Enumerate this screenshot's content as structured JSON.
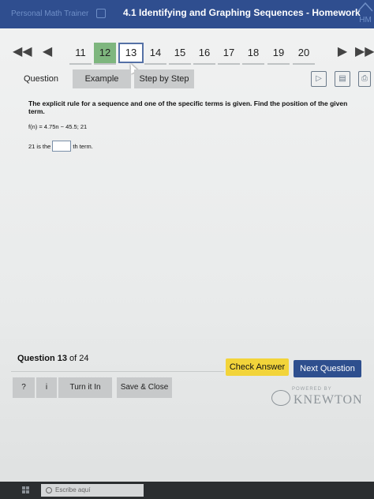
{
  "header": {
    "brand": "Personal Math Trainer",
    "title": "4.1 Identifying and Graphing Sequences - Homework",
    "logo": "HM"
  },
  "nav": {
    "questions": [
      {
        "label": "11",
        "state": "normal"
      },
      {
        "label": "12",
        "state": "done"
      },
      {
        "label": "13",
        "state": "current"
      },
      {
        "label": "14",
        "state": "normal"
      },
      {
        "label": "15",
        "state": "normal"
      },
      {
        "label": "16",
        "state": "normal"
      },
      {
        "label": "17",
        "state": "normal"
      },
      {
        "label": "18",
        "state": "normal"
      },
      {
        "label": "19",
        "state": "normal"
      },
      {
        "label": "20",
        "state": "normal"
      }
    ],
    "icons": {
      "first": "double-left-arrow-icon",
      "prev": "left-arrow-icon",
      "next": "right-arrow-icon",
      "last": "double-right-arrow-icon"
    }
  },
  "tabs": {
    "question": "Question",
    "example": "Example",
    "step_by_step": "Step by Step"
  },
  "tools": [
    "video-icon",
    "book-icon",
    "printer-icon"
  ],
  "question": {
    "prompt": "The explicit rule for a sequence and one of the specific terms is given. Find the position of the given term.",
    "rule": "f(n) = 4.75n − 45.5; 21",
    "answer_prefix": "21 is the",
    "answer_value": "",
    "answer_suffix": "th term."
  },
  "footer": {
    "question_label": "Question 13",
    "question_of": "of 24",
    "check_answer": "Check Answer",
    "next_question": "Next Question",
    "help": "?",
    "info": "i",
    "turn_it_in": "Turn it In",
    "save_close": "Save & Close",
    "powered_by": "POWERED BY",
    "knewton": "KNEWTON"
  },
  "taskbar": {
    "search_placeholder": "Escribe aquí"
  },
  "colors": {
    "header_bg": "#2f4e8f",
    "done_green": "#7eb67e",
    "check_yellow": "#f2d43a",
    "next_blue": "#2e4f8e"
  }
}
